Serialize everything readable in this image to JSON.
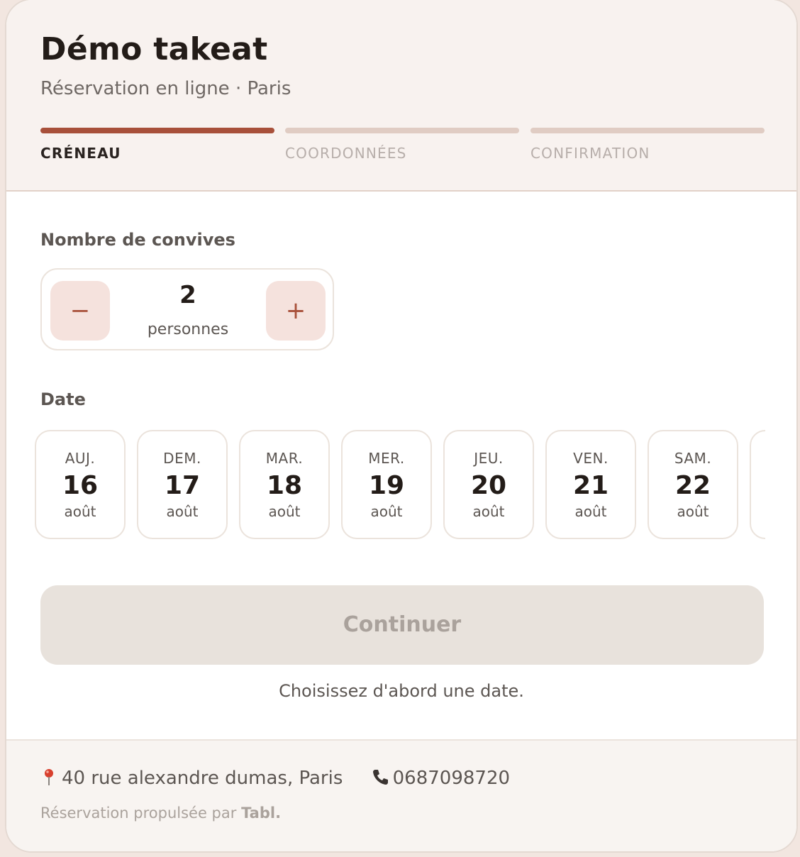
{
  "header": {
    "title": "Démo takeat",
    "subtitle": "Réservation en ligne · Paris",
    "steps": [
      {
        "label": "CRÉNEAU",
        "active": true
      },
      {
        "label": "COORDONNÉES",
        "active": false
      },
      {
        "label": "CONFIRMATION",
        "active": false
      }
    ]
  },
  "guests": {
    "label": "Nombre de convives",
    "decrement_symbol": "−",
    "increment_symbol": "+",
    "count": "2",
    "unit": "personnes"
  },
  "date": {
    "label": "Date",
    "days": [
      {
        "dow": "AUJ.",
        "day": "16",
        "month": "août"
      },
      {
        "dow": "DEM.",
        "day": "17",
        "month": "août"
      },
      {
        "dow": "MAR.",
        "day": "18",
        "month": "août"
      },
      {
        "dow": "MER.",
        "day": "19",
        "month": "août"
      },
      {
        "dow": "JEU.",
        "day": "20",
        "month": "août"
      },
      {
        "dow": "VEN.",
        "day": "21",
        "month": "août"
      },
      {
        "dow": "SAM.",
        "day": "22",
        "month": "août"
      }
    ]
  },
  "actions": {
    "continue_label": "Continuer",
    "hint": "Choisissez d'abord une date."
  },
  "footer": {
    "address": "40 rue alexandre dumas, Paris",
    "phone": "0687098720",
    "powered_prefix": "Réservation propulsée par ",
    "powered_brand": "Tabl."
  },
  "colors": {
    "accent": "#a8503a",
    "accent_soft": "#f5e2dd",
    "step_inactive": "#e0ccc3",
    "button_disabled": "#e8e2dc"
  },
  "icons": {
    "address": "pin-icon",
    "phone": "phone-icon"
  }
}
